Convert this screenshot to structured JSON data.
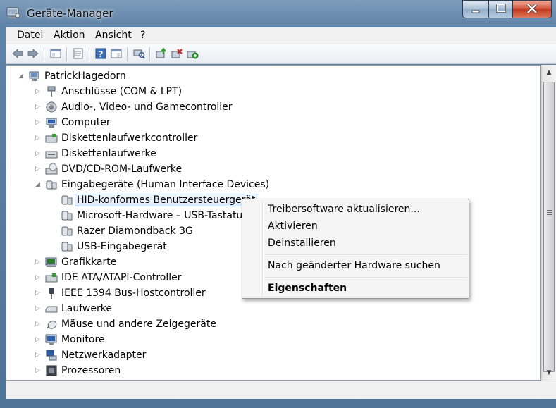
{
  "window": {
    "title": "Geräte-Manager",
    "icon": "device-manager-icon",
    "controls": {
      "minimize": "minimize-icon",
      "maximize": "maximize-icon",
      "close": "close-icon"
    }
  },
  "menubar": {
    "items": [
      "Datei",
      "Aktion",
      "Ansicht",
      "?"
    ]
  },
  "toolbar": {
    "buttons": [
      "back-icon",
      "forward-icon",
      "show-hide-console-tree-icon",
      "properties-icon",
      "help-icon",
      "view-icon",
      "scan-hardware-icon",
      "update-driver-icon",
      "uninstall-icon",
      "enable-device-icon"
    ]
  },
  "tree": {
    "root": "PatrickHagedorn",
    "items": [
      {
        "label": "Anschlüsse (COM & LPT)",
        "icon": "port-icon",
        "expanded": false
      },
      {
        "label": "Audio-, Video- und Gamecontroller",
        "icon": "speaker-icon",
        "expanded": false
      },
      {
        "label": "Computer",
        "icon": "computer-icon",
        "expanded": false
      },
      {
        "label": "Diskettenlaufwerkcontroller",
        "icon": "floppy-controller-icon",
        "expanded": false
      },
      {
        "label": "Diskettenlaufwerke",
        "icon": "floppy-drive-icon",
        "expanded": false
      },
      {
        "label": "DVD/CD-ROM-Laufwerke",
        "icon": "dvd-drive-icon",
        "expanded": false
      },
      {
        "label": "Eingabegeräte (Human Interface Devices)",
        "icon": "hid-icon",
        "expanded": true,
        "children": [
          {
            "label": "HID-konformes Benutzersteuergerät",
            "icon": "hid-device-icon",
            "selected": true
          },
          {
            "label": "Microsoft-Hardware – USB-Tastatur",
            "icon": "hid-device-icon"
          },
          {
            "label": "Razer Diamondback 3G",
            "icon": "hid-device-icon"
          },
          {
            "label": "USB-Eingabegerät",
            "icon": "hid-device-icon"
          }
        ]
      },
      {
        "label": "Grafikkarte",
        "icon": "display-adapter-icon",
        "expanded": false
      },
      {
        "label": "IDE ATA/ATAPI-Controller",
        "icon": "ide-controller-icon",
        "expanded": false
      },
      {
        "label": "IEEE 1394 Bus-Hostcontroller",
        "icon": "firewire-icon",
        "expanded": false
      },
      {
        "label": "Laufwerke",
        "icon": "disk-drive-icon",
        "expanded": false
      },
      {
        "label": "Mäuse und andere Zeigegeräte",
        "icon": "mouse-icon",
        "expanded": false
      },
      {
        "label": "Monitore",
        "icon": "monitor-icon",
        "expanded": false
      },
      {
        "label": "Netzwerkadapter",
        "icon": "network-adapter-icon",
        "expanded": false
      },
      {
        "label": "Prozessoren",
        "icon": "processor-icon",
        "expanded": false
      }
    ]
  },
  "context_menu": {
    "items": [
      {
        "label": "Treibersoftware aktualisieren...",
        "bold": false
      },
      {
        "label": "Aktivieren",
        "bold": false
      },
      {
        "label": "Deinstallieren",
        "bold": false
      },
      {
        "separator": true
      },
      {
        "label": "Nach geänderter Hardware suchen",
        "bold": false
      },
      {
        "separator": true
      },
      {
        "label": "Eigenschaften",
        "bold": true
      }
    ]
  },
  "colors": {
    "selection_border": "#7da2ce",
    "window_frame": "#5f83a8",
    "close_button": "#c0381e"
  }
}
